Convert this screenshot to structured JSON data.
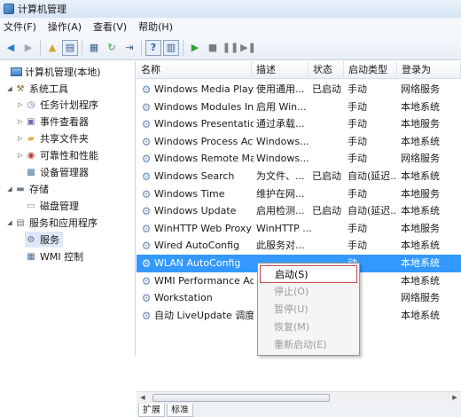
{
  "window": {
    "title": "计算机管理"
  },
  "menu": [
    "文件(F)",
    "操作(A)",
    "查看(V)",
    "帮助(H)"
  ],
  "tree": {
    "root": "计算机管理(本地)",
    "system_tools": "系统工具",
    "task_scheduler": "任务计划程序",
    "event_viewer": "事件查看器",
    "shared_folders": "共享文件夹",
    "reliability": "可靠性和性能",
    "device_manager": "设备管理器",
    "storage": "存储",
    "disk_mgmt": "磁盘管理",
    "services_apps": "服务和应用程序",
    "services": "服务",
    "wmi": "WMI 控制"
  },
  "columns": [
    "名称",
    "描述",
    "状态",
    "启动类型",
    "登录为"
  ],
  "rows": [
    [
      "Windows Media Play...",
      "使用通用...",
      "已启动",
      "手动",
      "网络服务"
    ],
    [
      "Windows Modules In...",
      "启用 Win...",
      "",
      "手动",
      "本地系统"
    ],
    [
      "Windows Presentatio...",
      "通过承载...",
      "",
      "手动",
      "本地服务"
    ],
    [
      "Windows Process Act...",
      "Windows...",
      "",
      "手动",
      "本地系统"
    ],
    [
      "Windows Remote Ma...",
      "Windows...",
      "",
      "手动",
      "网络服务"
    ],
    [
      "Windows Search",
      "为文件、...",
      "已启动",
      "自动(延迟...",
      "本地系统"
    ],
    [
      "Windows Time",
      "维护在网...",
      "",
      "手动",
      "本地服务"
    ],
    [
      "Windows Update",
      "启用检测...",
      "已启动",
      "自动(延迟...",
      "本地系统"
    ],
    [
      "WinHTTP Web Proxy ...",
      "WinHTTP ...",
      "",
      "手动",
      "本地服务"
    ],
    [
      "Wired AutoConfig",
      "此服务对...",
      "",
      "手动",
      "本地系统"
    ],
    [
      "WLAN AutoConfig",
      "",
      "",
      "动",
      "本地系统"
    ],
    [
      "WMI Performance Ad",
      "",
      "",
      "",
      "本地系统"
    ],
    [
      "Workstation",
      "",
      "",
      "",
      "网络服务"
    ],
    [
      "自动 LiveUpdate 调度",
      "",
      "",
      "",
      "本地系统"
    ]
  ],
  "selected_row": 10,
  "context_menu": [
    {
      "label": "启动(S)",
      "enabled": true
    },
    {
      "label": "停止(O)",
      "enabled": false
    },
    {
      "label": "暂停(U)",
      "enabled": false
    },
    {
      "label": "恢复(M)",
      "enabled": false
    },
    {
      "label": "重新启动(E)",
      "enabled": false
    }
  ],
  "tabs": [
    "扩展",
    "标准"
  ],
  "icons": {
    "back": "arrow-left-icon",
    "forward": "arrow-right-icon",
    "up": "folder-up-icon",
    "show-tree": "show-tree-icon",
    "properties": "properties-icon",
    "refresh": "refresh-icon",
    "export": "export-list-icon",
    "help": "help-icon",
    "start": "play-icon",
    "stop": "stop-icon",
    "pause": "pause-icon",
    "restart": "restart-icon"
  }
}
